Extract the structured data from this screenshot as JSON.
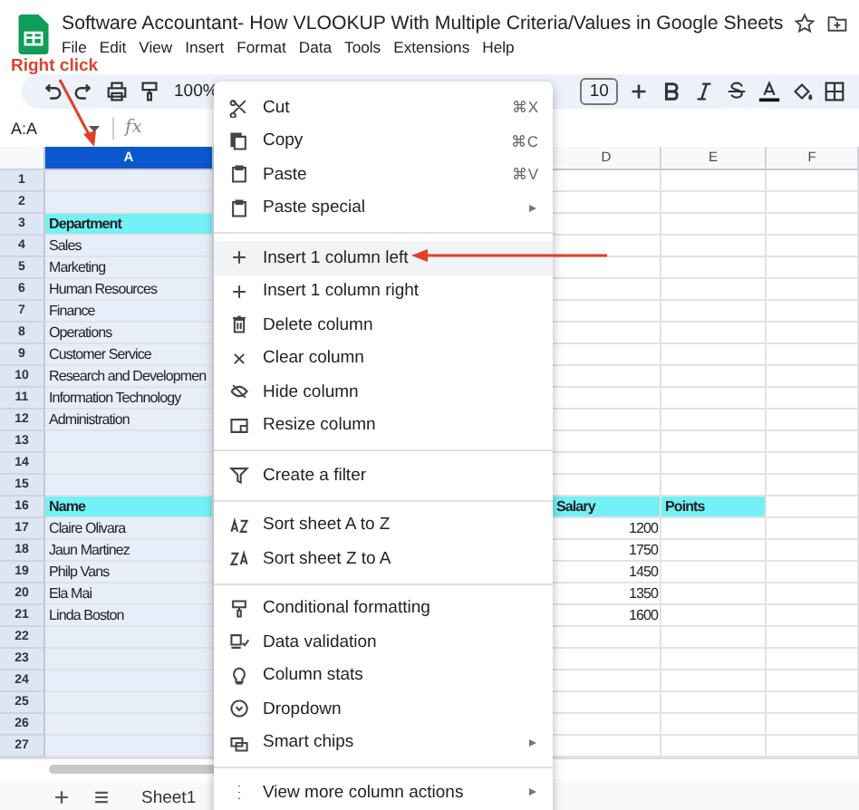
{
  "app": {
    "title": "Software Accountant- How VLOOKUP With Multiple Criteria/Values in Google Sheets",
    "menu": [
      "File",
      "Edit",
      "View",
      "Insert",
      "Format",
      "Data",
      "Tools",
      "Extensions",
      "Help"
    ]
  },
  "callout": {
    "label": "Right click"
  },
  "toolbar": {
    "zoom": "100%",
    "font_size": "10"
  },
  "formula_bar": {
    "name_box": "A:A",
    "fx": "fx"
  },
  "columns": [
    {
      "label": "A",
      "selected": true
    },
    {
      "label": "D",
      "selected": false
    },
    {
      "label": "E",
      "selected": false
    },
    {
      "label": "F",
      "selected": false
    }
  ],
  "rows": [
    {
      "num": "1"
    },
    {
      "num": "2"
    },
    {
      "num": "3",
      "highlight": true,
      "cells": {
        "A": {
          "text": "Department",
          "number": false
        }
      }
    },
    {
      "num": "4",
      "cells": {
        "A": {
          "text": "Sales",
          "number": false
        }
      }
    },
    {
      "num": "5",
      "cells": {
        "A": {
          "text": "Marketing",
          "number": false
        }
      }
    },
    {
      "num": "6",
      "cells": {
        "A": {
          "text": "Human Resources",
          "number": false
        }
      }
    },
    {
      "num": "7",
      "cells": {
        "A": {
          "text": "Finance",
          "number": false
        }
      }
    },
    {
      "num": "8",
      "cells": {
        "A": {
          "text": "Operations",
          "number": false
        }
      }
    },
    {
      "num": "9",
      "cells": {
        "A": {
          "text": "Customer Service",
          "number": false
        }
      }
    },
    {
      "num": "10",
      "cells": {
        "A": {
          "text": "Research and Developmen",
          "number": false
        }
      }
    },
    {
      "num": "11",
      "cells": {
        "A": {
          "text": "Information Technology",
          "number": false
        }
      }
    },
    {
      "num": "12",
      "cells": {
        "A": {
          "text": "Administration",
          "number": false
        }
      }
    },
    {
      "num": "13"
    },
    {
      "num": "14"
    },
    {
      "num": "15"
    },
    {
      "num": "16",
      "highlight": true,
      "cells": {
        "A": {
          "text": "Name",
          "number": false
        },
        "D": {
          "text": "Salary",
          "number": false
        },
        "E": {
          "text": "Points",
          "number": false
        }
      }
    },
    {
      "num": "17",
      "cells": {
        "A": {
          "text": "Claire Olivara",
          "number": false
        },
        "D": {
          "text": "1200",
          "number": true
        }
      }
    },
    {
      "num": "18",
      "cells": {
        "A": {
          "text": "Jaun Martinez",
          "number": false
        },
        "D": {
          "text": "1750",
          "number": true
        }
      }
    },
    {
      "num": "19",
      "cells": {
        "A": {
          "text": "Philp Vans",
          "number": false
        },
        "D": {
          "text": "1450",
          "number": true
        }
      }
    },
    {
      "num": "20",
      "cells": {
        "A": {
          "text": "Ela Mai",
          "number": false
        },
        "D": {
          "text": "1350",
          "number": true
        }
      }
    },
    {
      "num": "21",
      "cells": {
        "A": {
          "text": "Linda Boston",
          "number": false
        },
        "D": {
          "text": "1600",
          "number": true
        }
      }
    },
    {
      "num": "22"
    },
    {
      "num": "23"
    },
    {
      "num": "24"
    },
    {
      "num": "25"
    },
    {
      "num": "26"
    },
    {
      "num": "27"
    }
  ],
  "sheet_tabs": [
    {
      "label": "Sheet1",
      "selected": true
    }
  ],
  "context_menu": [
    {
      "kind": "item",
      "label": "Cut",
      "shortcut": "⌘X",
      "submenu": false,
      "selected": false
    },
    {
      "kind": "item",
      "label": "Copy",
      "shortcut": "⌘C",
      "submenu": false,
      "selected": false
    },
    {
      "kind": "item",
      "label": "Paste",
      "shortcut": "⌘V",
      "submenu": false,
      "selected": false
    },
    {
      "kind": "item",
      "label": "Paste special",
      "submenu": true,
      "selected": false
    },
    {
      "kind": "divider"
    },
    {
      "kind": "item",
      "label": "Insert 1 column left",
      "submenu": false,
      "selected": true
    },
    {
      "kind": "item",
      "label": "Insert 1 column right",
      "submenu": false,
      "selected": false
    },
    {
      "kind": "item",
      "label": "Delete column",
      "submenu": false,
      "selected": false
    },
    {
      "kind": "item",
      "label": "Clear column",
      "submenu": false,
      "selected": false
    },
    {
      "kind": "item",
      "label": "Hide column",
      "submenu": false,
      "selected": false
    },
    {
      "kind": "item",
      "label": "Resize column",
      "submenu": false,
      "selected": false
    },
    {
      "kind": "divider"
    },
    {
      "kind": "item",
      "label": "Create a filter",
      "submenu": false,
      "selected": false
    },
    {
      "kind": "divider"
    },
    {
      "kind": "item",
      "label": "Sort sheet A to Z",
      "submenu": false,
      "selected": false
    },
    {
      "kind": "item",
      "label": "Sort sheet Z to A",
      "submenu": false,
      "selected": false
    },
    {
      "kind": "divider"
    },
    {
      "kind": "item",
      "label": "Conditional formatting",
      "submenu": false,
      "selected": false
    },
    {
      "kind": "item",
      "label": "Data validation",
      "submenu": false,
      "selected": false
    },
    {
      "kind": "item",
      "label": "Column stats",
      "submenu": false,
      "selected": false
    },
    {
      "kind": "item",
      "label": "Dropdown",
      "submenu": false,
      "selected": false
    },
    {
      "kind": "item",
      "label": "Smart chips",
      "submenu": true,
      "selected": false
    },
    {
      "kind": "divider"
    },
    {
      "kind": "item",
      "label": "View more column actions",
      "submenu": true,
      "selected": false
    }
  ]
}
